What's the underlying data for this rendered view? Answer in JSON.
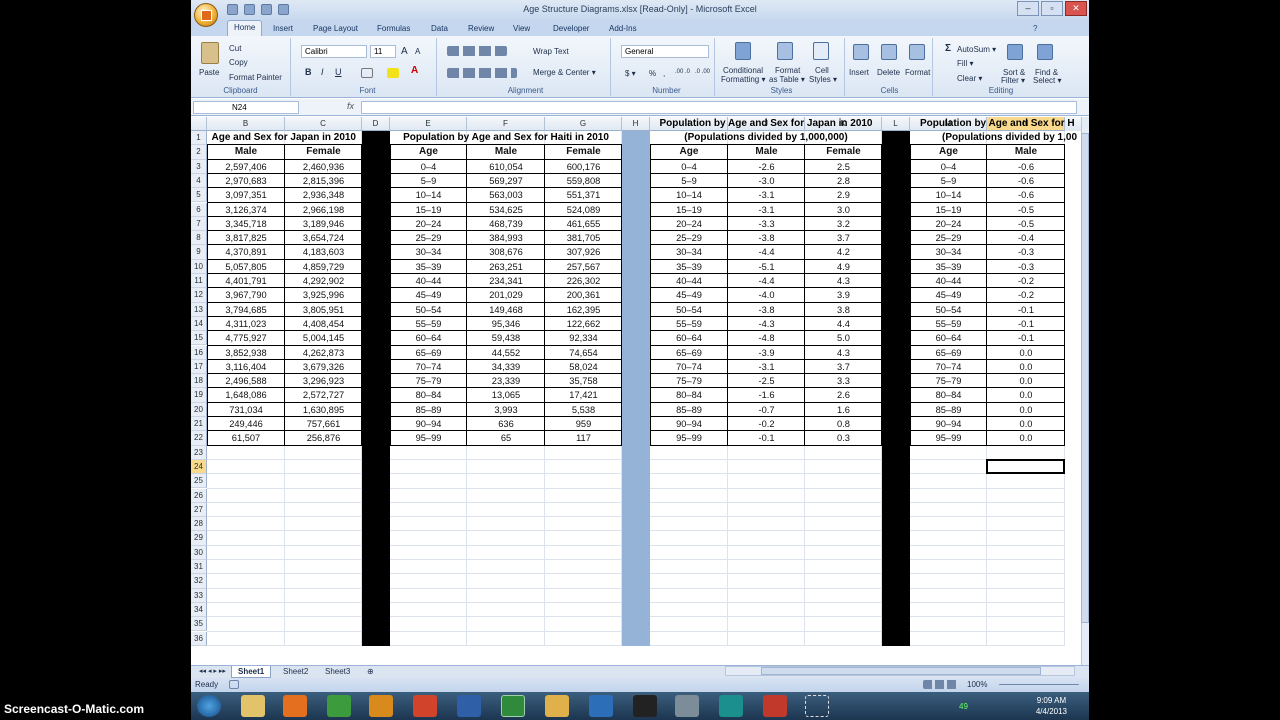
{
  "window": {
    "title": "Age Structure Diagrams.xlsx  [Read-Only] - Microsoft Excel",
    "help_glyph": "?",
    "controls": [
      "–",
      "▫",
      "✕"
    ]
  },
  "ribbon_tabs": [
    "Home",
    "Insert",
    "Page Layout",
    "Formulas",
    "Data",
    "Review",
    "View",
    "Developer",
    "Add-Ins"
  ],
  "ribbon": {
    "clipboard": {
      "label": "Clipboard",
      "paste": "Paste",
      "cut": "Cut",
      "copy": "Copy",
      "format_painter": "Format Painter"
    },
    "font": {
      "label": "Font",
      "name": "Calibri",
      "size": "11",
      "grow": "A",
      "shrink": "A",
      "bold": "B",
      "italic": "I",
      "underline": "U",
      "font_color_letter": "A"
    },
    "alignment": {
      "label": "Alignment",
      "wrap_text": "Wrap Text",
      "merge_center": "Merge & Center ▾"
    },
    "number": {
      "label": "Number",
      "format": "General",
      "currency": "$ ▾",
      "percent": "%",
      "comma": ",",
      "inc_dec": ".00 .0",
      "dec_dec": ".0 .00"
    },
    "styles": {
      "label": "Styles",
      "conditional": "Conditional",
      "conditional2": "Formatting ▾",
      "format_table": "Format",
      "format_table2": "as Table ▾",
      "cell_styles": "Cell",
      "cell_styles2": "Styles ▾"
    },
    "cells": {
      "label": "Cells",
      "insert": "Insert",
      "delete": "Delete",
      "format": "Format"
    },
    "editing": {
      "label": "Editing",
      "autosum": "AutoSum ▾",
      "fill": "Fill ▾",
      "clear": "Clear ▾",
      "sort": "Sort &",
      "sort2": "Filter ▾",
      "find": "Find &",
      "find2": "Select ▾"
    }
  },
  "formula_bar": {
    "name_box": "N24",
    "fx": "fx",
    "formula": ""
  },
  "columns": [
    {
      "letter": "B",
      "selected": false
    },
    {
      "letter": "C",
      "selected": false
    },
    {
      "letter": "D",
      "selected": false
    },
    {
      "letter": "E",
      "selected": false
    },
    {
      "letter": "F",
      "selected": false
    },
    {
      "letter": "G",
      "selected": false
    },
    {
      "letter": "H",
      "selected": false
    },
    {
      "letter": "I",
      "selected": false
    },
    {
      "letter": "J",
      "selected": false
    },
    {
      "letter": "K",
      "selected": false
    },
    {
      "letter": "L",
      "selected": false
    },
    {
      "letter": "M",
      "selected": false
    },
    {
      "letter": "N",
      "selected": true
    }
  ],
  "selected_row": "24",
  "row_numbers": [
    "1",
    "2",
    "3",
    "4",
    "5",
    "6",
    "7",
    "8",
    "9",
    "10",
    "11",
    "12",
    "13",
    "14",
    "15",
    "16",
    "17",
    "18",
    "19",
    "20",
    "21",
    "22",
    "23",
    "24",
    "25",
    "26",
    "27",
    "28",
    "29",
    "30",
    "31",
    "32",
    "33",
    "34",
    "35",
    "36"
  ],
  "table1": {
    "title": "Age and Sex for Japan in 2010",
    "headers": [
      "Male",
      "Female"
    ],
    "rows": [
      [
        "2,597,406",
        "2,460,936"
      ],
      [
        "2,970,683",
        "2,815,396"
      ],
      [
        "3,097,351",
        "2,936,348"
      ],
      [
        "3,126,374",
        "2,966,198"
      ],
      [
        "3,345,718",
        "3,189,946"
      ],
      [
        "3,817,825",
        "3,654,724"
      ],
      [
        "4,370,891",
        "4,183,603"
      ],
      [
        "5,057,805",
        "4,859,729"
      ],
      [
        "4,401,791",
        "4,292,902"
      ],
      [
        "3,967,790",
        "3,925,996"
      ],
      [
        "3,794,685",
        "3,805,951"
      ],
      [
        "4,311,023",
        "4,408,454"
      ],
      [
        "4,775,927",
        "5,004,145"
      ],
      [
        "3,852,938",
        "4,262,873"
      ],
      [
        "3,116,404",
        "3,679,326"
      ],
      [
        "2,496,588",
        "3,296,923"
      ],
      [
        "1,648,086",
        "2,572,727"
      ],
      [
        "731,034",
        "1,630,895"
      ],
      [
        "249,446",
        "757,661"
      ],
      [
        "61,507",
        "256,876"
      ]
    ]
  },
  "table2": {
    "title": "Population by Age and Sex for Haiti in 2010",
    "headers": [
      "Age",
      "Male",
      "Female"
    ],
    "rows": [
      [
        "0–4",
        "610,054",
        "600,176"
      ],
      [
        "5–9",
        "569,297",
        "559,808"
      ],
      [
        "10–14",
        "563,003",
        "551,371"
      ],
      [
        "15–19",
        "534,625",
        "524,089"
      ],
      [
        "20–24",
        "468,739",
        "461,655"
      ],
      [
        "25–29",
        "384,993",
        "381,705"
      ],
      [
        "30–34",
        "308,676",
        "307,926"
      ],
      [
        "35–39",
        "263,251",
        "257,567"
      ],
      [
        "40–44",
        "234,341",
        "226,302"
      ],
      [
        "45–49",
        "201,029",
        "200,361"
      ],
      [
        "50–54",
        "149,468",
        "162,395"
      ],
      [
        "55–59",
        "95,346",
        "122,662"
      ],
      [
        "60–64",
        "59,438",
        "92,334"
      ],
      [
        "65–69",
        "44,552",
        "74,654"
      ],
      [
        "70–74",
        "34,339",
        "58,024"
      ],
      [
        "75–79",
        "23,339",
        "35,758"
      ],
      [
        "80–84",
        "13,065",
        "17,421"
      ],
      [
        "85–89",
        "3,993",
        "5,538"
      ],
      [
        "90–94",
        "636",
        "959"
      ],
      [
        "95–99",
        "65",
        "117"
      ]
    ]
  },
  "table3": {
    "title1": "Population by Age and Sex for Japan in 2010",
    "title2": "(Populations divided by 1,000,000)",
    "headers": [
      "Age",
      "Male",
      "Female"
    ],
    "rows": [
      [
        "0–4",
        "-2.6",
        "2.5"
      ],
      [
        "5–9",
        "-3.0",
        "2.8"
      ],
      [
        "10–14",
        "-3.1",
        "2.9"
      ],
      [
        "15–19",
        "-3.1",
        "3.0"
      ],
      [
        "20–24",
        "-3.3",
        "3.2"
      ],
      [
        "25–29",
        "-3.8",
        "3.7"
      ],
      [
        "30–34",
        "-4.4",
        "4.2"
      ],
      [
        "35–39",
        "-5.1",
        "4.9"
      ],
      [
        "40–44",
        "-4.4",
        "4.3"
      ],
      [
        "45–49",
        "-4.0",
        "3.9"
      ],
      [
        "50–54",
        "-3.8",
        "3.8"
      ],
      [
        "55–59",
        "-4.3",
        "4.4"
      ],
      [
        "60–64",
        "-4.8",
        "5.0"
      ],
      [
        "65–69",
        "-3.9",
        "4.3"
      ],
      [
        "70–74",
        "-3.1",
        "3.7"
      ],
      [
        "75–79",
        "-2.5",
        "3.3"
      ],
      [
        "80–84",
        "-1.6",
        "2.6"
      ],
      [
        "85–89",
        "-0.7",
        "1.6"
      ],
      [
        "90–94",
        "-0.2",
        "0.8"
      ],
      [
        "95–99",
        "-0.1",
        "0.3"
      ]
    ]
  },
  "table4": {
    "title1": "Population by Age and Sex for H",
    "title2": "(Populations divided by 1,00",
    "headers": [
      "Age",
      "Male"
    ],
    "rows": [
      [
        "0–4",
        "-0.6"
      ],
      [
        "5–9",
        "-0.6"
      ],
      [
        "10–14",
        "-0.6"
      ],
      [
        "15–19",
        "-0.5"
      ],
      [
        "20–24",
        "-0.5"
      ],
      [
        "25–29",
        "-0.4"
      ],
      [
        "30–34",
        "-0.3"
      ],
      [
        "35–39",
        "-0.3"
      ],
      [
        "40–44",
        "-0.2"
      ],
      [
        "45–49",
        "-0.2"
      ],
      [
        "50–54",
        "-0.1"
      ],
      [
        "55–59",
        "-0.1"
      ],
      [
        "60–64",
        "-0.1"
      ],
      [
        "65–69",
        "0.0"
      ],
      [
        "70–74",
        "0.0"
      ],
      [
        "75–79",
        "0.0"
      ],
      [
        "80–84",
        "0.0"
      ],
      [
        "85–89",
        "0.0"
      ],
      [
        "90–94",
        "0.0"
      ],
      [
        "95–99",
        "0.0"
      ]
    ]
  },
  "sheets": [
    {
      "name": "Sheet1",
      "active": true
    },
    {
      "name": "Sheet2",
      "active": false
    },
    {
      "name": "Sheet3",
      "active": false
    }
  ],
  "status": {
    "ready": "Ready",
    "zoom": "100%"
  },
  "taskbar": {
    "time": "9:09 AM",
    "date": "4/4/2013",
    "tray_number": "49"
  },
  "watermark": "Screencast-O-Matic.com",
  "colors": {
    "accent": "#c5d7ee",
    "selected_header": "#f9d98b",
    "spacer_blue": "#95b3d7",
    "spacer_black": "#000000"
  }
}
